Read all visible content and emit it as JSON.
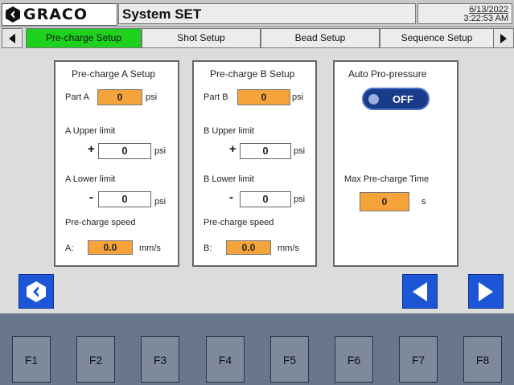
{
  "header": {
    "brand": "GRACO",
    "title": "System SET",
    "date": "6/13/2022",
    "time": "3:22:53 AM"
  },
  "tabs": [
    {
      "label": "Pre-charge Setup",
      "active": true
    },
    {
      "label": "Shot Setup",
      "active": false
    },
    {
      "label": "Bead Setup",
      "active": false
    },
    {
      "label": "Sequence Setup",
      "active": false
    }
  ],
  "panel_a": {
    "title": "Pre-charge A Setup",
    "part_label": "Part A",
    "part_value": "0",
    "part_unit": "psi",
    "upper_label": "A Upper limit",
    "upper_sign": "+",
    "upper_value": "0",
    "upper_unit": "psi",
    "lower_label": "A Lower limit",
    "lower_sign": "-",
    "lower_value": "0",
    "lower_unit": "psi",
    "speed_label": "Pre-charge speed",
    "speed_prefix": "A:",
    "speed_value": "0.0",
    "speed_unit": "mm/s"
  },
  "panel_b": {
    "title": "Pre-charge B Setup",
    "part_label": "Part B",
    "part_value": "0",
    "part_unit": "psi",
    "upper_label": "B Upper limit",
    "upper_sign": "+",
    "upper_value": "0",
    "upper_unit": "psi",
    "lower_label": "B Lower limit",
    "lower_sign": "-",
    "lower_value": "0",
    "lower_unit": "psi",
    "speed_label": "Pre-charge speed",
    "speed_prefix": "B:",
    "speed_value": "0.0",
    "speed_unit": "mm/s"
  },
  "panel_auto": {
    "title": "Auto Pro-pressure",
    "toggle_label": "OFF",
    "max_time_label": "Max Pre-charge Time",
    "max_time_value": "0",
    "max_time_unit": "s"
  },
  "function_keys": [
    "F1",
    "F2",
    "F3",
    "F4",
    "F5",
    "F6",
    "F7",
    "F8"
  ],
  "colors": {
    "active_tab": "#1fd11f",
    "value_field": "#f5a43c",
    "nav_button": "#1c56d6",
    "function_strip": "#68778c"
  },
  "icons": {
    "logo": "graco-logo-icon",
    "tab_left": "triangle-left-icon",
    "tab_right": "triangle-right-icon",
    "home": "graco-home-icon",
    "back": "arrow-left-icon",
    "forward": "arrow-right-icon"
  }
}
